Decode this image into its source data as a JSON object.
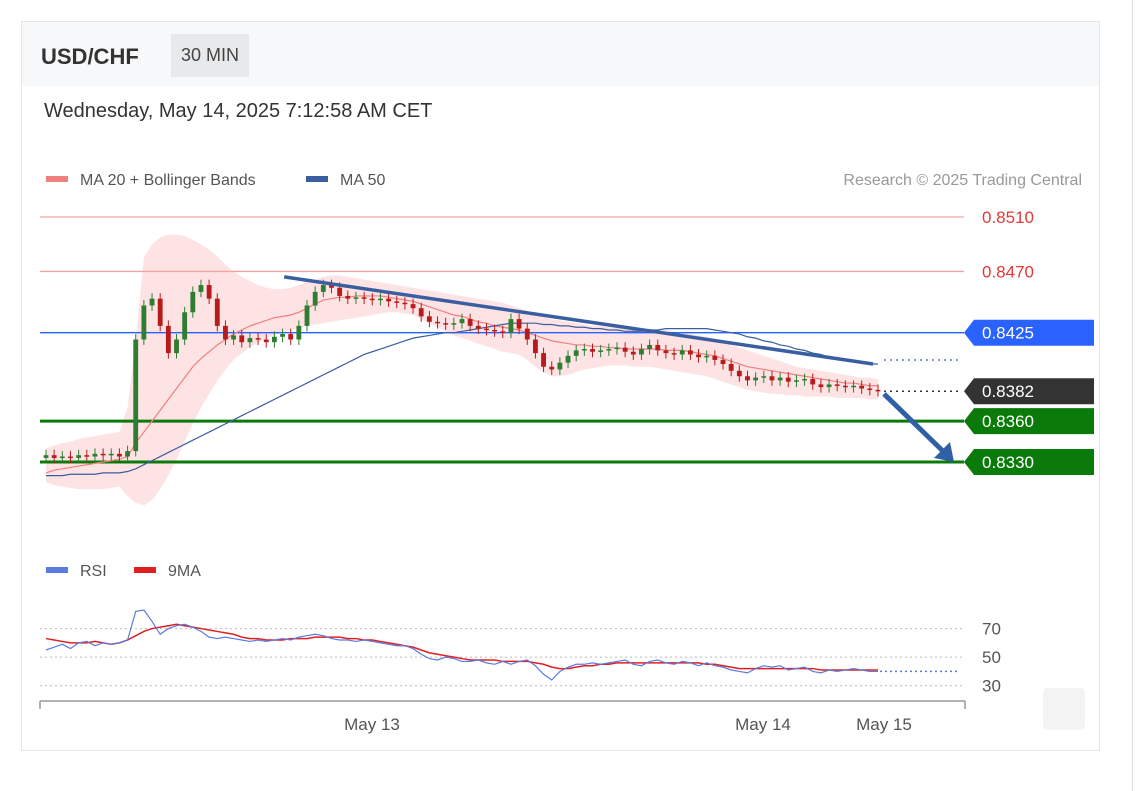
{
  "header": {
    "pair": "USD/CHF",
    "timeframe": "30 MIN"
  },
  "datetime": "Wednesday, May 14, 2025 7:12:58 AM CET",
  "legend": {
    "ma20": "MA 20 + Bollinger Bands",
    "ma50": "MA 50",
    "credit": "Research © 2025 Trading Central"
  },
  "rsi_legend": {
    "rsi": "RSI",
    "ma9": "9MA"
  },
  "colors": {
    "resistance": "#f4a3a3",
    "pivot": "#2962ff",
    "support": "#0a7a0a",
    "current": "#333333",
    "ma20": "#f08080",
    "ma50": "#3a5fa0",
    "band": "#fde0e0",
    "rsi": "#5b7be0",
    "rsi_ma": "#e02020",
    "arrow": "#2f5fa5"
  },
  "levels": [
    {
      "name": "resistance-2",
      "price": 0.851,
      "label": "0.8510",
      "style": "resistance"
    },
    {
      "name": "resistance-1",
      "price": 0.847,
      "label": "0.8470",
      "style": "resistance"
    },
    {
      "name": "pivot",
      "price": 0.8425,
      "label": "0.8425",
      "style": "pivot"
    },
    {
      "name": "current-price",
      "price": 0.8382,
      "label": "0.8382",
      "style": "current"
    },
    {
      "name": "support-1",
      "price": 0.836,
      "label": "0.8360",
      "style": "support"
    },
    {
      "name": "support-2",
      "price": 0.833,
      "label": "0.8330",
      "style": "support"
    }
  ],
  "chart_data": {
    "type": "candlestick",
    "symbol": "USD/CHF",
    "interval": "30 MIN",
    "x_ticks": [
      "May 13",
      "May 14",
      "May 15"
    ],
    "ylim": [
      0.8305,
      0.852
    ],
    "closes": [
      0.8335,
      0.8333,
      0.8334,
      0.8333,
      0.8335,
      0.8334,
      0.8336,
      0.8335,
      0.8336,
      0.8334,
      0.8338,
      0.842,
      0.8445,
      0.845,
      0.843,
      0.841,
      0.842,
      0.844,
      0.8455,
      0.846,
      0.845,
      0.843,
      0.842,
      0.8423,
      0.8418,
      0.8421,
      0.842,
      0.8418,
      0.8422,
      0.8424,
      0.842,
      0.843,
      0.8445,
      0.8455,
      0.846,
      0.8458,
      0.8452,
      0.845,
      0.8451,
      0.845,
      0.8449,
      0.845,
      0.8448,
      0.8447,
      0.8446,
      0.8443,
      0.8437,
      0.8433,
      0.8432,
      0.8431,
      0.8432,
      0.8435,
      0.843,
      0.8428,
      0.8427,
      0.8426,
      0.8425,
      0.8435,
      0.8428,
      0.842,
      0.841,
      0.84,
      0.8398,
      0.8403,
      0.8408,
      0.8412,
      0.8413,
      0.8411,
      0.8412,
      0.8413,
      0.8414,
      0.8411,
      0.8409,
      0.8413,
      0.8416,
      0.8412,
      0.841,
      0.8409,
      0.8412,
      0.8409,
      0.8407,
      0.8408,
      0.8405,
      0.8402,
      0.8397,
      0.8393,
      0.839,
      0.8392,
      0.8393,
      0.839,
      0.8392,
      0.8389,
      0.839,
      0.8391,
      0.8387,
      0.8385,
      0.8387,
      0.8386,
      0.8385,
      0.8386,
      0.8384,
      0.8383,
      0.8382
    ],
    "ma20": [
      0.8322,
      0.8324,
      0.8325,
      0.8326,
      0.8327,
      0.8328,
      0.8329,
      0.833,
      0.8331,
      0.8332,
      0.8334,
      0.8344,
      0.8352,
      0.836,
      0.8368,
      0.8376,
      0.8384,
      0.8392,
      0.84,
      0.8406,
      0.8411,
      0.8416,
      0.842,
      0.8424,
      0.8427,
      0.843,
      0.8432,
      0.8434,
      0.8436,
      0.8437,
      0.8438,
      0.844,
      0.8443,
      0.8446,
      0.8449,
      0.845,
      0.8451,
      0.8451,
      0.8452,
      0.8452,
      0.8452,
      0.8452,
      0.8451,
      0.845,
      0.8449,
      0.8448,
      0.8446,
      0.8444,
      0.8442,
      0.844,
      0.8438,
      0.8437,
      0.8435,
      0.8433,
      0.8432,
      0.843,
      0.8429,
      0.8428,
      0.8427,
      0.8425,
      0.8423,
      0.8421,
      0.8419,
      0.8418,
      0.8417,
      0.8416,
      0.8416,
      0.8415,
      0.8415,
      0.8414,
      0.8414,
      0.8413,
      0.8413,
      0.8413,
      0.8413,
      0.8413,
      0.8412,
      0.8412,
      0.8412,
      0.8411,
      0.841,
      0.8409,
      0.8408,
      0.8406,
      0.8404,
      0.8402,
      0.84,
      0.8399,
      0.8398,
      0.8397,
      0.8396,
      0.8395,
      0.8394,
      0.8393,
      0.8392,
      0.8391,
      0.839,
      0.8389,
      0.8388,
      0.8388,
      0.8387,
      0.8386,
      0.8386
    ],
    "band_upper": [
      0.834,
      0.8342,
      0.8344,
      0.8345,
      0.8347,
      0.8348,
      0.8349,
      0.835,
      0.8351,
      0.8352,
      0.837,
      0.842,
      0.848,
      0.849,
      0.8495,
      0.8497,
      0.8497,
      0.8496,
      0.8493,
      0.849,
      0.8486,
      0.8481,
      0.8475,
      0.847,
      0.8466,
      0.8463,
      0.846,
      0.8458,
      0.8457,
      0.8457,
      0.8458,
      0.846,
      0.8462,
      0.8464,
      0.8466,
      0.8467,
      0.8467,
      0.8466,
      0.8465,
      0.8464,
      0.8463,
      0.8462,
      0.8461,
      0.846,
      0.8459,
      0.8458,
      0.8457,
      0.8456,
      0.8455,
      0.8454,
      0.8453,
      0.8452,
      0.8451,
      0.845,
      0.8449,
      0.8448,
      0.8447,
      0.8445,
      0.8443,
      0.8441,
      0.8439,
      0.8437,
      0.8435,
      0.8434,
      0.8433,
      0.8432,
      0.8431,
      0.843,
      0.843,
      0.8429,
      0.8429,
      0.8428,
      0.8428,
      0.8428,
      0.8428,
      0.8427,
      0.8427,
      0.8426,
      0.8425,
      0.8424,
      0.8423,
      0.8422,
      0.842,
      0.8418,
      0.8416,
      0.8414,
      0.8412,
      0.841,
      0.8408,
      0.8406,
      0.8404,
      0.8402,
      0.84,
      0.8399,
      0.8398,
      0.8397,
      0.8396,
      0.8395,
      0.8394,
      0.8393,
      0.8392,
      0.8392,
      0.8391
    ],
    "band_lower": [
      0.8315,
      0.8313,
      0.8312,
      0.8311,
      0.831,
      0.831,
      0.831,
      0.831,
      0.8311,
      0.8312,
      0.8305,
      0.83,
      0.8298,
      0.8302,
      0.831,
      0.832,
      0.8332,
      0.8345,
      0.8358,
      0.837,
      0.838,
      0.839,
      0.8398,
      0.8405,
      0.841,
      0.8414,
      0.8418,
      0.8421,
      0.8423,
      0.8425,
      0.8427,
      0.8428,
      0.843,
      0.8431,
      0.8432,
      0.8433,
      0.8434,
      0.8435,
      0.8436,
      0.8437,
      0.8438,
      0.8439,
      0.844,
      0.844,
      0.8439,
      0.8438,
      0.8435,
      0.8432,
      0.8429,
      0.8426,
      0.8423,
      0.8421,
      0.8419,
      0.8417,
      0.8415,
      0.8413,
      0.8411,
      0.841,
      0.8409,
      0.8405,
      0.84,
      0.8396,
      0.8393,
      0.8393,
      0.8394,
      0.8396,
      0.8398,
      0.8399,
      0.84,
      0.8401,
      0.8401,
      0.8401,
      0.84,
      0.84,
      0.84,
      0.8399,
      0.8398,
      0.8397,
      0.8396,
      0.8395,
      0.8394,
      0.8393,
      0.8391,
      0.8389,
      0.8387,
      0.8385,
      0.8383,
      0.8382,
      0.8381,
      0.838,
      0.838,
      0.8379,
      0.8379,
      0.8378,
      0.8378,
      0.8378,
      0.8378,
      0.8377,
      0.8377,
      0.8377,
      0.8377,
      0.8376,
      0.8376
    ],
    "ma50": [
      0.832,
      0.832,
      0.832,
      0.8321,
      0.8321,
      0.8321,
      0.8321,
      0.8322,
      0.8322,
      0.8322,
      0.8323,
      0.8325,
      0.8328,
      0.8331,
      0.8334,
      0.8337,
      0.834,
      0.8343,
      0.8346,
      0.8349,
      0.8352,
      0.8355,
      0.8358,
      0.8361,
      0.8364,
      0.8367,
      0.837,
      0.8373,
      0.8376,
      0.8379,
      0.8382,
      0.8385,
      0.8388,
      0.8391,
      0.8394,
      0.8397,
      0.84,
      0.8403,
      0.8406,
      0.8409,
      0.8411,
      0.8413,
      0.8415,
      0.8417,
      0.8419,
      0.8421,
      0.8422,
      0.8423,
      0.8424,
      0.8425,
      0.8425,
      0.8426,
      0.8427,
      0.8428,
      0.8429,
      0.843,
      0.8431,
      0.8432,
      0.8432,
      0.8432,
      0.8432,
      0.8431,
      0.8431,
      0.843,
      0.843,
      0.8429,
      0.8429,
      0.8428,
      0.8428,
      0.8427,
      0.8427,
      0.8426,
      0.8426,
      0.8426,
      0.8427,
      0.8427,
      0.8428,
      0.8428,
      0.8428,
      0.8428,
      0.8428,
      0.8428,
      0.8427,
      0.8426,
      0.8425,
      0.8424,
      0.8422,
      0.8421,
      0.8419,
      0.8418,
      0.8416,
      0.8415,
      0.8413,
      0.8412,
      0.841,
      0.8409,
      0.8407,
      0.8406,
      0.8405,
      0.8404,
      0.8403,
      0.8402,
      0.8402
    ],
    "trendline": [
      [
        0.1,
        0.8466
      ],
      [
        0.97,
        0.8402
      ]
    ],
    "forecast_arrow": [
      [
        0.0,
        0.838
      ],
      [
        1.0,
        0.833
      ]
    ],
    "rsi": {
      "levels": [
        70,
        50,
        30
      ],
      "ylim": [
        20,
        90
      ],
      "values": [
        55,
        57,
        59,
        56,
        60,
        61,
        58,
        60,
        59,
        60,
        62,
        82,
        83,
        75,
        66,
        70,
        72,
        73,
        71,
        68,
        64,
        63,
        64,
        63,
        62,
        61,
        62,
        61,
        62,
        63,
        62,
        64,
        65,
        66,
        65,
        63,
        62,
        62,
        61,
        62,
        61,
        60,
        59,
        58,
        58,
        56,
        52,
        49,
        48,
        50,
        49,
        47,
        47,
        48,
        46,
        45,
        47,
        45,
        47,
        48,
        44,
        38,
        34,
        40,
        43,
        45,
        45,
        46,
        45,
        46,
        47,
        48,
        45,
        44,
        47,
        48,
        46,
        45,
        47,
        46,
        44,
        46,
        44,
        43,
        41,
        40,
        39,
        42,
        44,
        43,
        44,
        41,
        42,
        43,
        40,
        39,
        41,
        40,
        41,
        42,
        41,
        40,
        40
      ],
      "ma9": [
        63,
        62,
        61,
        60,
        60,
        60,
        61,
        60,
        59,
        60,
        62,
        65,
        68,
        70,
        71,
        72,
        73,
        72,
        71,
        70,
        69,
        68,
        67,
        66,
        64,
        63,
        63,
        62,
        62,
        62,
        63,
        63,
        63,
        64,
        64,
        64,
        64,
        63,
        63,
        62,
        62,
        61,
        60,
        59,
        58,
        57,
        55,
        53,
        52,
        51,
        50,
        49,
        48,
        48,
        48,
        48,
        47,
        47,
        47,
        47,
        46,
        45,
        43,
        42,
        42,
        43,
        44,
        44,
        45,
        45,
        46,
        46,
        46,
        46,
        46,
        46,
        46,
        46,
        46,
        46,
        46,
        45,
        45,
        44,
        43,
        42,
        42,
        42,
        42,
        42,
        42,
        42,
        42,
        42,
        42,
        41,
        41,
        41,
        41,
        41,
        41,
        41,
        41
      ]
    }
  }
}
